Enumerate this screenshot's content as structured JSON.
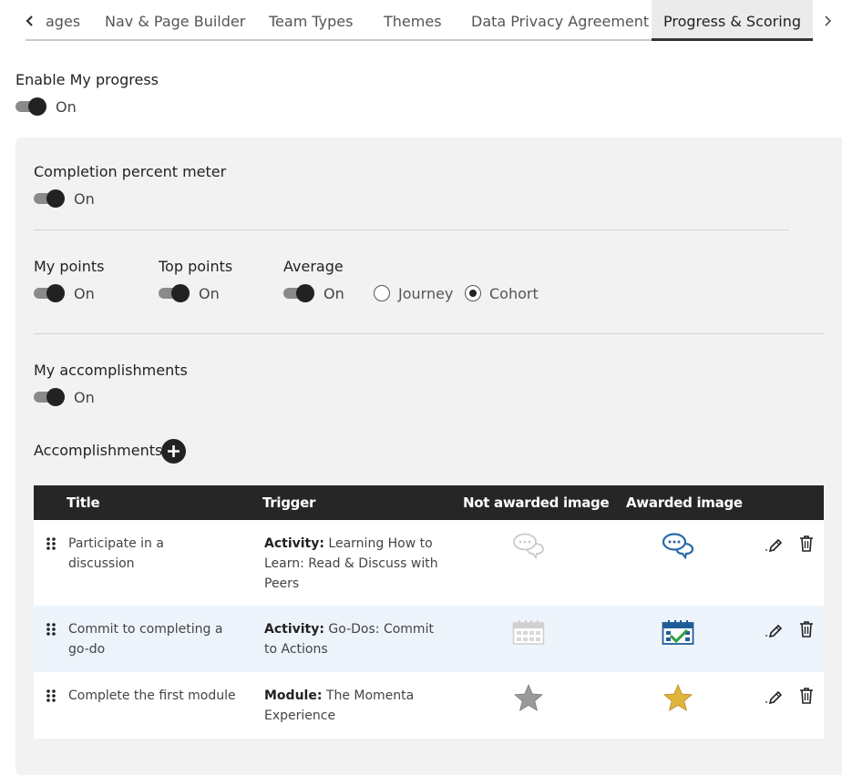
{
  "tabs": {
    "items": [
      {
        "label": "ages"
      },
      {
        "label": "Nav & Page Builder"
      },
      {
        "label": "Team Types"
      },
      {
        "label": "Themes"
      },
      {
        "label": "Data Privacy Agreement"
      },
      {
        "label": "Progress & Scoring",
        "active": true
      }
    ]
  },
  "enable_progress": {
    "label": "Enable My progress",
    "state": "On"
  },
  "completion_meter": {
    "label": "Completion percent meter",
    "state": "On"
  },
  "my_points": {
    "label": "My points",
    "state": "On"
  },
  "top_points": {
    "label": "Top points",
    "state": "On"
  },
  "average": {
    "label": "Average",
    "state": "On",
    "options": [
      {
        "label": "Journey",
        "selected": false
      },
      {
        "label": "Cohort",
        "selected": true
      }
    ]
  },
  "my_accomplishments": {
    "label": "My accomplishments",
    "state": "On"
  },
  "accomplishments": {
    "label": "Accomplishments",
    "columns": {
      "title": "Title",
      "trigger": "Trigger",
      "not_awarded": "Not awarded image",
      "awarded": "Awarded image"
    },
    "rows": [
      {
        "title": "Participate in a discussion",
        "trigger_type": "Activity:",
        "trigger_text": "Learning How to Learn: Read & Discuss with Peers",
        "icon": "discussion-icon"
      },
      {
        "title": "Commit to completing a go-do",
        "trigger_type": "Activity:",
        "trigger_text": "Go-Dos: Commit to Actions",
        "icon": "calendar-check-icon"
      },
      {
        "title": "Complete the first module",
        "trigger_type": "Module:",
        "trigger_text": "The Momenta Experience",
        "icon": "star-icon"
      }
    ]
  },
  "colors": {
    "header_bg": "#262626",
    "panel_bg": "#f2f2f2",
    "alt_row": "#eef4fb",
    "awarded_blue": "#2a6aa8",
    "awarded_gold": "#e0b43a",
    "check_green": "#2f9e3a"
  }
}
